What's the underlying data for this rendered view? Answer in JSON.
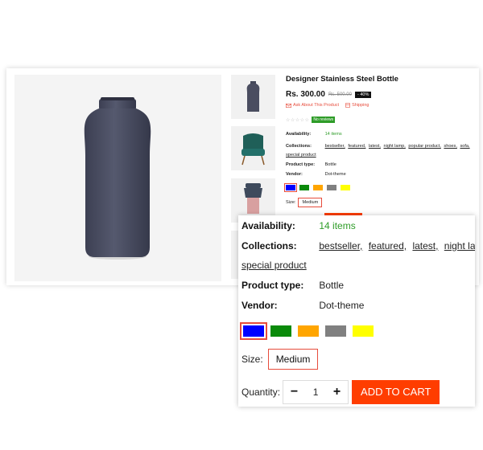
{
  "product": {
    "title": "Designer Stainless Steel Bottle",
    "price": "Rs. 300.00",
    "old_price": "Rs. 500.00",
    "discount": "- 40%",
    "ask_link": "Ask About This Product",
    "shipping_link": "Shipping",
    "stars": "☆☆☆☆☆",
    "no_reviews": "No reviews",
    "availability_label": "Availability:",
    "availability_value": "14 items",
    "collections_label": "Collections:",
    "collections": [
      "bestseller,",
      "featured,",
      "latest,",
      "night lamp,",
      "popular product,",
      "shoes,",
      "sofa,",
      "special product"
    ],
    "collections_zoom": [
      "bestseller,",
      "featured,",
      "latest,",
      "night lamp,"
    ],
    "product_type_label": "Product type:",
    "product_type_value": "Bottle",
    "vendor_label": "Vendor:",
    "vendor_value": "Dot-theme",
    "size_label": "Size:",
    "size_value": "Medium",
    "quantity_label": "Quantity:",
    "quantity_value": "1",
    "minus": "−",
    "plus": "+",
    "add_to_cart": "ADD TO CART",
    "swatches": [
      "#0000ff",
      "#0a8a0a",
      "#ffa500",
      "#808080",
      "#ffff00"
    ]
  },
  "colors": {
    "accent": "#ff3d00",
    "link": "#e74c3c",
    "in_stock": "#2e9c28"
  },
  "icons": [
    "mail-icon",
    "shipping-icon",
    "star-icon"
  ]
}
